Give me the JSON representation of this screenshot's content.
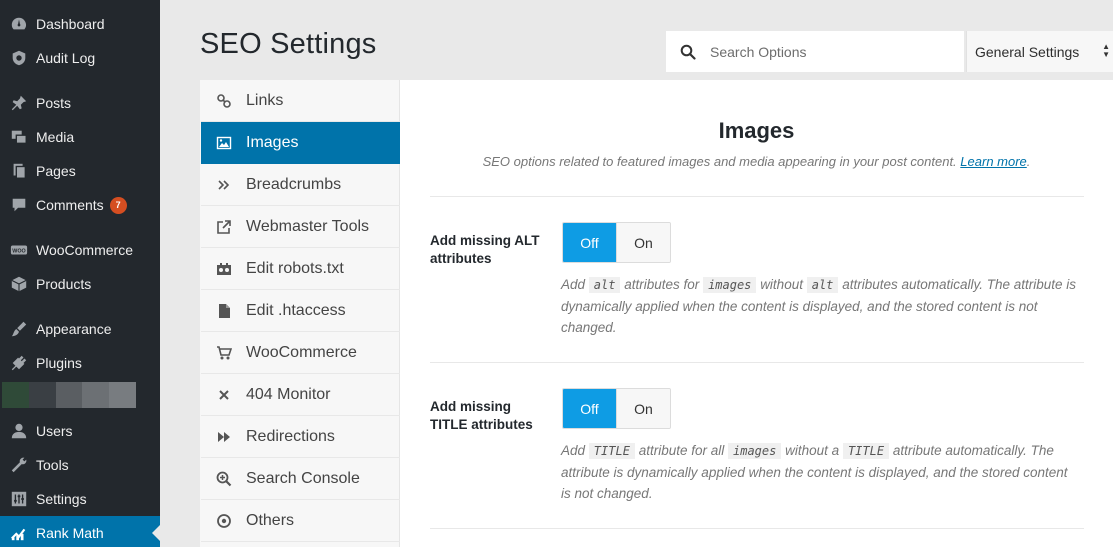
{
  "wp_menu": {
    "items": [
      {
        "label": "Dashboard",
        "icon": "dashboard-icon"
      },
      {
        "label": "Audit Log",
        "icon": "audit-log-icon"
      },
      {
        "label": "Posts",
        "icon": "pin-icon"
      },
      {
        "label": "Media",
        "icon": "media-icon"
      },
      {
        "label": "Pages",
        "icon": "pages-icon"
      },
      {
        "label": "Comments",
        "icon": "comments-icon",
        "badge": "7"
      },
      {
        "label": "WooCommerce",
        "icon": "woocommerce-icon"
      },
      {
        "label": "Products",
        "icon": "products-icon"
      },
      {
        "label": "Appearance",
        "icon": "appearance-icon"
      },
      {
        "label": "Plugins",
        "icon": "plugins-icon"
      },
      {
        "label": "Users",
        "icon": "users-icon"
      },
      {
        "label": "Tools",
        "icon": "tools-icon"
      },
      {
        "label": "Settings",
        "icon": "settings-icon"
      },
      {
        "label": "Rank Math",
        "icon": "rank-math-icon",
        "active": true
      }
    ]
  },
  "header": {
    "title": "SEO Settings",
    "search_placeholder": "Search Options",
    "select_value": "General Settings"
  },
  "settings_nav": {
    "items": [
      {
        "label": "Links",
        "icon": "link-icon"
      },
      {
        "label": "Images",
        "icon": "image-icon",
        "active": true
      },
      {
        "label": "Breadcrumbs",
        "icon": "double-chevron-icon"
      },
      {
        "label": "Webmaster Tools",
        "icon": "external-link-icon"
      },
      {
        "label": "Edit robots.txt",
        "icon": "robot-icon"
      },
      {
        "label": "Edit .htaccess",
        "icon": "file-icon"
      },
      {
        "label": "WooCommerce",
        "icon": "cart-icon"
      },
      {
        "label": "404 Monitor",
        "icon": "close-icon"
      },
      {
        "label": "Redirections",
        "icon": "forward-icon"
      },
      {
        "label": "Search Console",
        "icon": "search-plus-icon"
      },
      {
        "label": "Others",
        "icon": "circle-dot-icon"
      }
    ]
  },
  "content": {
    "title": "Images",
    "description": "SEO options related to featured images and media appearing in your post content.",
    "learn_more": "Learn more",
    "fields": [
      {
        "label_line1": "Add missing ALT",
        "label_line2": "attributes",
        "off": "Off",
        "on": "On",
        "selected": "Off",
        "desc_parts": {
          "p1": "Add",
          "c1": "alt",
          "p2": "attributes for",
          "c2": "images",
          "p3": "without",
          "c3": "alt",
          "p4": "attributes automatically. The attribute is dynamically applied when the content is displayed, and the stored content is not changed."
        }
      },
      {
        "label_line1": "Add missing",
        "label_line2": "TITLE attributes",
        "off": "Off",
        "on": "On",
        "selected": "Off",
        "desc_parts": {
          "p1": "Add",
          "c1": "TITLE",
          "p2": "attribute for all",
          "c2": "images",
          "p3": "without a",
          "c3": "TITLE",
          "p4": "attribute automatically. The attribute is dynamically applied when the content is displayed, and the stored content is not changed."
        }
      }
    ]
  },
  "colors": {
    "sidebar_bg": "#23282d",
    "accent": "#0073aa",
    "toggle_on": "#0e9ce4",
    "badge": "#d54e21"
  }
}
